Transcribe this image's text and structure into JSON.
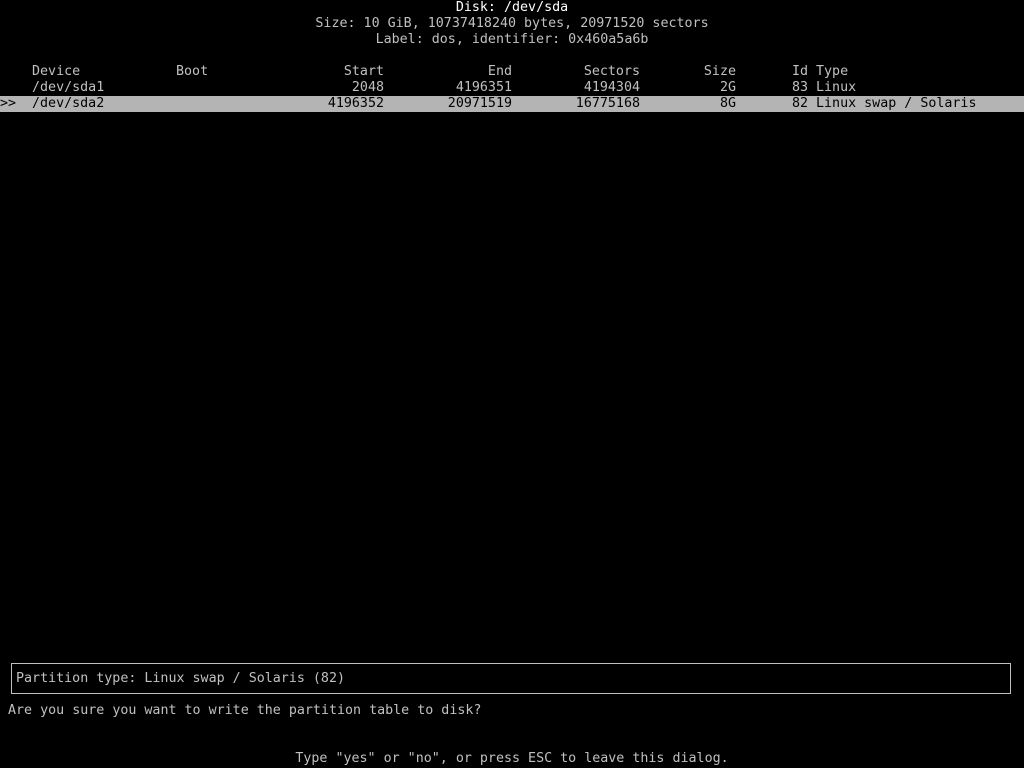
{
  "header": {
    "disk": "Disk: /dev/sda",
    "size": "Size: 10 GiB, 10737418240 bytes, 20971520 sectors",
    "label": "Label: dos, identifier: 0x460a5a6b"
  },
  "table": {
    "columns": {
      "device": "Device",
      "boot": "Boot",
      "start": "Start",
      "end": "End",
      "sectors": "Sectors",
      "size": "Size",
      "id": "Id",
      "type": "Type"
    },
    "rows": [
      {
        "marker": "",
        "device": "/dev/sda1",
        "boot": "",
        "start": "2048",
        "end": "4196351",
        "sectors": "4194304",
        "size": "2G",
        "id": "83",
        "type": "Linux",
        "selected": false
      },
      {
        "marker": ">>",
        "device": "/dev/sda2",
        "boot": "",
        "start": "4196352",
        "end": "20971519",
        "sectors": "16775168",
        "size": "8G",
        "id": "82",
        "type": "Linux swap / Solaris",
        "selected": true
      }
    ]
  },
  "info": {
    "partition_type": "Partition type: Linux swap / Solaris (82)"
  },
  "prompt": {
    "question": "Are you sure you want to write the partition table to disk?",
    "hint": "Type \"yes\" or \"no\", or press ESC to leave this dialog."
  },
  "colors": {
    "background": "#000000",
    "text": "#c0c0c0",
    "selection_background": "#b4b4b4",
    "selection_text": "#000000"
  }
}
